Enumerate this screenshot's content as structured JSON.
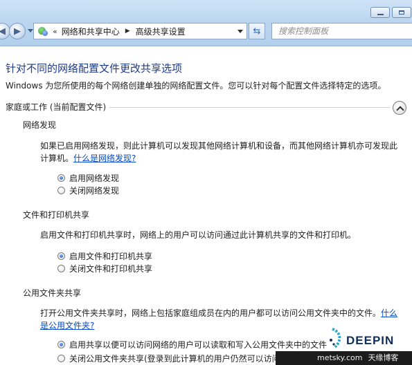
{
  "nav": {
    "breadcrumb_chevron": "«",
    "breadcrumb": [
      "网络和共享中心",
      "高级共享设置"
    ],
    "search_placeholder": "搜索控制面板"
  },
  "page": {
    "title": "针对不同的网络配置文件更改共享选项",
    "intro": "Windows 为您所使用的每个网络创建单独的网络配置文件。您可以针对每个配置文件选择特定的选项。",
    "group_title": "家庭或工作 (当前配置文件)"
  },
  "sections": [
    {
      "heading": "网络发现",
      "description": "如果已启用网络发现，则此计算机可以发现其他网络计算机和设备，而其他网络计算机亦可发现此计算机。",
      "link": "什么是网络发现?",
      "options": [
        {
          "label": "启用网络发现",
          "selected": true
        },
        {
          "label": "关闭网络发现",
          "selected": false
        }
      ]
    },
    {
      "heading": "文件和打印机共享",
      "description": "启用文件和打印机共享时，网络上的用户可以访问通过此计算机共享的文件和打印机。",
      "options": [
        {
          "label": "启用文件和打印机共享",
          "selected": true
        },
        {
          "label": "关闭文件和打印机共享",
          "selected": false
        }
      ]
    },
    {
      "heading": "公用文件夹共享",
      "description": "打开公用文件夹共享时，网络上包括家庭组成员在内的用户都可以访问公用文件夹中的文件。",
      "link": "什么是公用文件夹?",
      "options": [
        {
          "label": "启用共享以便可以访问网络的用户可以读取和写入公用文件夹中的文件",
          "selected": true
        },
        {
          "label": "关闭公用文件夹共享(登录到此计算机的用户仍然可以访问这些文件夹)",
          "selected": false
        }
      ]
    }
  ],
  "watermark": {
    "brand": "DEEPIN",
    "url": "metsky.com",
    "name": "天缘博客"
  }
}
